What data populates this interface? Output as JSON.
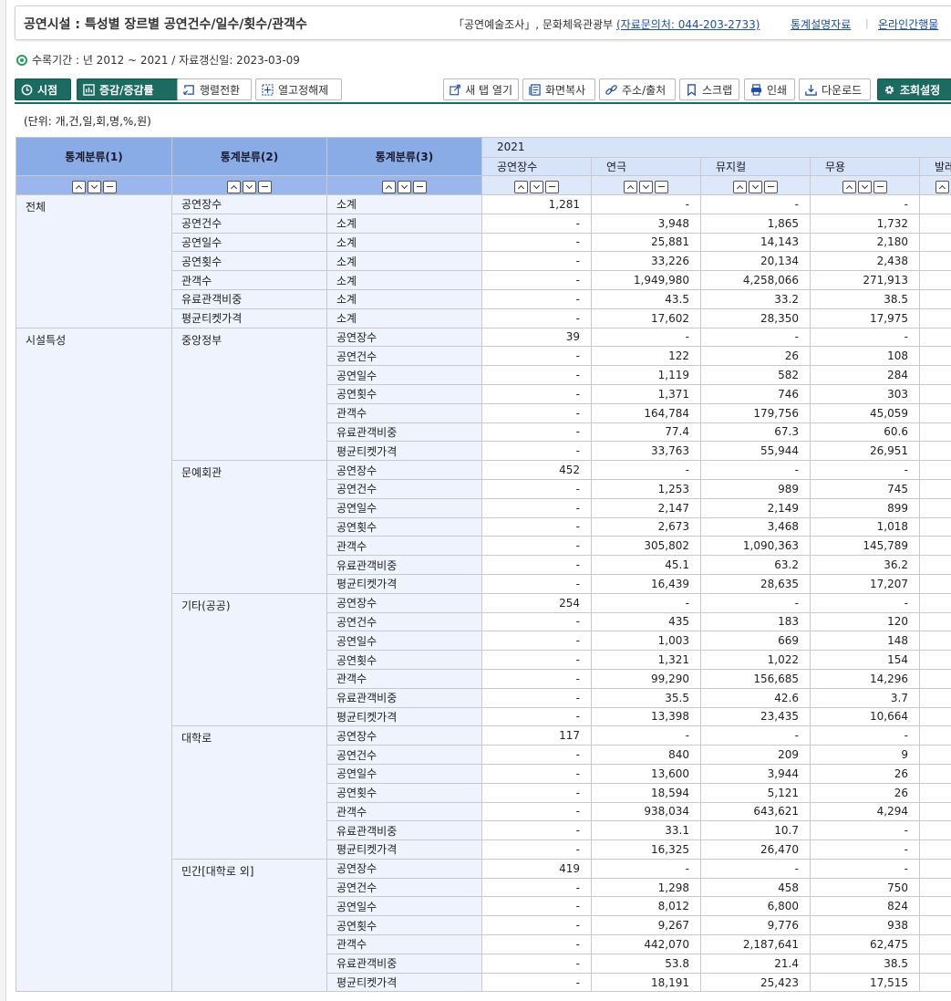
{
  "header": {
    "title": "공연시설 : 특성별 장르별 공연건수/일수/횟수/관객수",
    "source_prefix": "「공연예술조사」, 문화체육관광부",
    "contact": "(자료문의처: 044-203-2733)",
    "link_stat_desc": "통계설명자료",
    "link_online": "온라인간행물"
  },
  "period": "수록기간 : 년 2012 ~ 2021 / 자료갱신일: 2023-03-09",
  "toolbar": {
    "point": "시점",
    "change": "증감/증감률",
    "pivot": "행렬전환",
    "unfreeze": "열고정해제",
    "new_tab": "새 탭 열기",
    "screen_copy": "화면복사",
    "address": "주소/출처",
    "scrap": "스크랩",
    "print": "인쇄",
    "download": "다운로드",
    "settings": "조회설정"
  },
  "unit": "(단위: 개,건,일,회,명,%,원)",
  "table": {
    "dim_headers": [
      "통계분류(1)",
      "통계분류(2)",
      "통계분류(3)"
    ],
    "year": "2021",
    "columns": [
      "공연장수",
      "연극",
      "뮤지컬",
      "무용",
      "발레"
    ],
    "sections": [
      {
        "d1": "전체",
        "groups": [
          {
            "d2": null,
            "rows": [
              {
                "d2": "공연장수",
                "d3": "소계",
                "v": [
                  "1,281",
                  "-",
                  "-",
                  "-"
                ]
              },
              {
                "d2": "공연건수",
                "d3": "소계",
                "v": [
                  "-",
                  "3,948",
                  "1,865",
                  "1,732"
                ]
              },
              {
                "d2": "공연일수",
                "d3": "소계",
                "v": [
                  "-",
                  "25,881",
                  "14,143",
                  "2,180"
                ]
              },
              {
                "d2": "공연횟수",
                "d3": "소계",
                "v": [
                  "-",
                  "33,226",
                  "20,134",
                  "2,438"
                ]
              },
              {
                "d2": "관객수",
                "d3": "소계",
                "v": [
                  "-",
                  "1,949,980",
                  "4,258,066",
                  "271,913"
                ]
              },
              {
                "d2": "유료관객비중",
                "d3": "소계",
                "v": [
                  "-",
                  "43.5",
                  "33.2",
                  "38.5"
                ]
              },
              {
                "d2": "평균티켓가격",
                "d3": "소계",
                "v": [
                  "-",
                  "17,602",
                  "28,350",
                  "17,975"
                ]
              }
            ]
          }
        ]
      },
      {
        "d1": "시설특성",
        "groups": [
          {
            "d2": "중앙정부",
            "rows": [
              {
                "d3": "공연장수",
                "v": [
                  "39",
                  "-",
                  "-",
                  "-"
                ]
              },
              {
                "d3": "공연건수",
                "v": [
                  "-",
                  "122",
                  "26",
                  "108"
                ]
              },
              {
                "d3": "공연일수",
                "v": [
                  "-",
                  "1,119",
                  "582",
                  "284"
                ]
              },
              {
                "d3": "공연횟수",
                "v": [
                  "-",
                  "1,371",
                  "746",
                  "303"
                ]
              },
              {
                "d3": "관객수",
                "v": [
                  "-",
                  "164,784",
                  "179,756",
                  "45,059"
                ]
              },
              {
                "d3": "유료관객비중",
                "v": [
                  "-",
                  "77.4",
                  "67.3",
                  "60.6"
                ]
              },
              {
                "d3": "평균티켓가격",
                "v": [
                  "-",
                  "33,763",
                  "55,944",
                  "26,951"
                ]
              }
            ]
          },
          {
            "d2": "문예회관",
            "rows": [
              {
                "d3": "공연장수",
                "v": [
                  "452",
                  "-",
                  "-",
                  "-"
                ]
              },
              {
                "d3": "공연건수",
                "v": [
                  "-",
                  "1,253",
                  "989",
                  "745"
                ]
              },
              {
                "d3": "공연일수",
                "v": [
                  "-",
                  "2,147",
                  "2,149",
                  "899"
                ]
              },
              {
                "d3": "공연횟수",
                "v": [
                  "-",
                  "2,673",
                  "3,468",
                  "1,018"
                ]
              },
              {
                "d3": "관객수",
                "v": [
                  "-",
                  "305,802",
                  "1,090,363",
                  "145,789"
                ]
              },
              {
                "d3": "유료관객비중",
                "v": [
                  "-",
                  "45.1",
                  "63.2",
                  "36.2"
                ]
              },
              {
                "d3": "평균티켓가격",
                "v": [
                  "-",
                  "16,439",
                  "28,635",
                  "17,207"
                ]
              }
            ]
          },
          {
            "d2": "기타(공공)",
            "rows": [
              {
                "d3": "공연장수",
                "v": [
                  "254",
                  "-",
                  "-",
                  "-"
                ]
              },
              {
                "d3": "공연건수",
                "v": [
                  "-",
                  "435",
                  "183",
                  "120"
                ]
              },
              {
                "d3": "공연일수",
                "v": [
                  "-",
                  "1,003",
                  "669",
                  "148"
                ]
              },
              {
                "d3": "공연횟수",
                "v": [
                  "-",
                  "1,321",
                  "1,022",
                  "154"
                ]
              },
              {
                "d3": "관객수",
                "v": [
                  "-",
                  "99,290",
                  "156,685",
                  "14,296"
                ]
              },
              {
                "d3": "유료관객비중",
                "v": [
                  "-",
                  "35.5",
                  "42.6",
                  "3.7"
                ]
              },
              {
                "d3": "평균티켓가격",
                "v": [
                  "-",
                  "13,398",
                  "23,435",
                  "10,664"
                ]
              }
            ]
          },
          {
            "d2": "대학로",
            "rows": [
              {
                "d3": "공연장수",
                "v": [
                  "117",
                  "-",
                  "-",
                  "-"
                ]
              },
              {
                "d3": "공연건수",
                "v": [
                  "-",
                  "840",
                  "209",
                  "9"
                ]
              },
              {
                "d3": "공연일수",
                "v": [
                  "-",
                  "13,600",
                  "3,944",
                  "26"
                ]
              },
              {
                "d3": "공연횟수",
                "v": [
                  "-",
                  "18,594",
                  "5,121",
                  "26"
                ]
              },
              {
                "d3": "관객수",
                "v": [
                  "-",
                  "938,034",
                  "643,621",
                  "4,294"
                ]
              },
              {
                "d3": "유료관객비중",
                "v": [
                  "-",
                  "33.1",
                  "10.7",
                  "-"
                ]
              },
              {
                "d3": "평균티켓가격",
                "v": [
                  "-",
                  "16,325",
                  "26,470",
                  "-"
                ]
              }
            ]
          },
          {
            "d2": "민간[대학로 외]",
            "rows": [
              {
                "d3": "공연장수",
                "v": [
                  "419",
                  "-",
                  "-",
                  "-"
                ]
              },
              {
                "d3": "공연건수",
                "v": [
                  "-",
                  "1,298",
                  "458",
                  "750"
                ]
              },
              {
                "d3": "공연일수",
                "v": [
                  "-",
                  "8,012",
                  "6,800",
                  "824"
                ]
              },
              {
                "d3": "공연횟수",
                "v": [
                  "-",
                  "9,267",
                  "9,776",
                  "938"
                ]
              },
              {
                "d3": "관객수",
                "v": [
                  "-",
                  "442,070",
                  "2,187,641",
                  "62,475"
                ]
              },
              {
                "d3": "유료관객비중",
                "v": [
                  "-",
                  "53.8",
                  "21.4",
                  "38.5"
                ]
              },
              {
                "d3": "평균티켓가격",
                "v": [
                  "-",
                  "18,191",
                  "25,423",
                  "17,515"
                ]
              }
            ]
          }
        ]
      }
    ]
  }
}
